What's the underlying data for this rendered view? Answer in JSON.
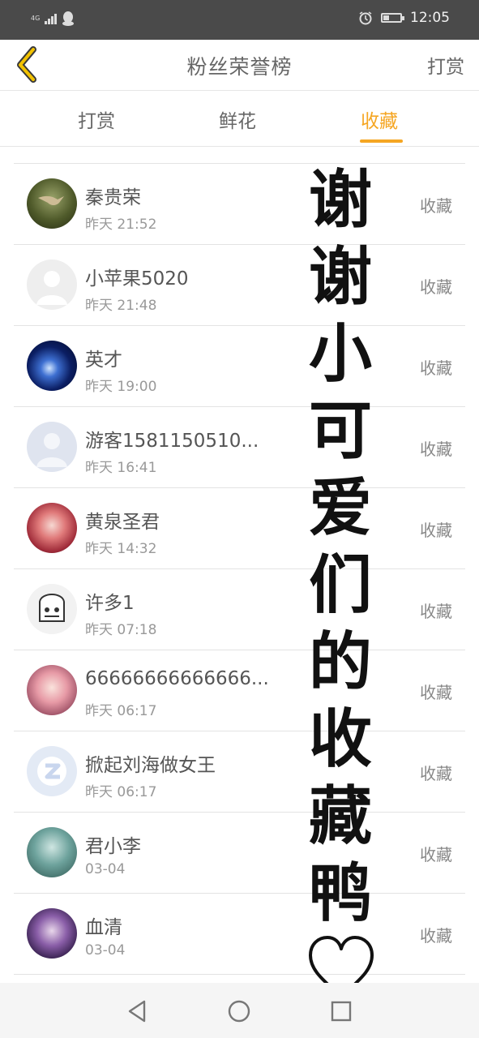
{
  "status_bar": {
    "network": "4G",
    "time": "12:05",
    "icons": [
      "signal-icon",
      "qq-icon",
      "alarm-icon",
      "battery-icon"
    ]
  },
  "header": {
    "back_icon": "chevron-left-icon",
    "title": "粉丝荣誉榜",
    "action": "打赏"
  },
  "tabs": [
    {
      "label": "打赏",
      "active": false
    },
    {
      "label": "鲜花",
      "active": false
    },
    {
      "label": "收藏",
      "active": true
    }
  ],
  "rows": [
    {
      "name": "秦贵荣",
      "time": "昨天 21:52",
      "action": "收藏"
    },
    {
      "name": "小苹果5020",
      "time": "昨天 21:48",
      "action": "收藏"
    },
    {
      "name": "英才",
      "time": "昨天 19:00",
      "action": "收藏"
    },
    {
      "name": "游客1581150510...",
      "time": "昨天 16:41",
      "action": "收藏"
    },
    {
      "name": "黄泉圣君",
      "time": "昨天 14:32",
      "action": "收藏"
    },
    {
      "name": "许多1",
      "time": "昨天 07:18",
      "action": "收藏"
    },
    {
      "name": "66666666666666...",
      "time": "昨天 06:17",
      "action": "收藏"
    },
    {
      "name": "掀起刘海做女王",
      "time": "昨天 06:17",
      "action": "收藏"
    },
    {
      "name": "君小李",
      "time": "03-04",
      "action": "收藏"
    },
    {
      "name": "血清",
      "time": "03-04",
      "action": "收藏"
    }
  ],
  "overlay": {
    "chars": [
      "谢",
      "谢",
      "小",
      "可",
      "爱",
      "们",
      "的",
      "收",
      "藏",
      "鸭"
    ],
    "symbol": "heart-icon"
  },
  "navbar": {
    "icons": [
      "back-triangle-icon",
      "home-circle-icon",
      "recents-square-icon"
    ]
  },
  "colors": {
    "accent": "#f5a623",
    "status_bar": "#4a4a4a",
    "text": "#555555",
    "muted": "#999999"
  }
}
